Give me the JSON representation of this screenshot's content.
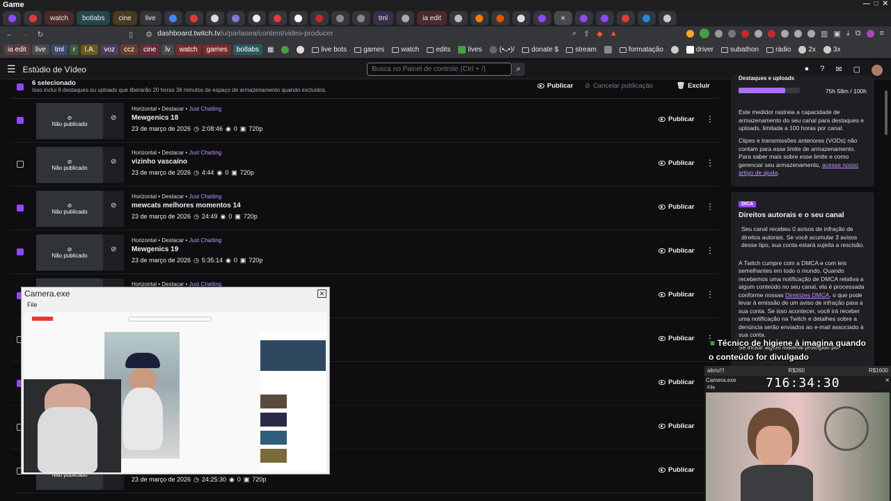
{
  "os_title": "Game",
  "tabs": [
    {
      "label": "",
      "kind": "icon"
    },
    {
      "label": "",
      "kind": "icon"
    },
    {
      "label": "watch",
      "kind": "group"
    },
    {
      "label": "botlabs",
      "kind": "group"
    },
    {
      "label": "cine",
      "kind": "group"
    },
    {
      "label": "live",
      "kind": "group"
    },
    {
      "label": "tml",
      "kind": "group"
    },
    {
      "label": "ia edit",
      "kind": "group"
    }
  ],
  "url": {
    "host": "dashboard.twitch.tv",
    "path": "/u/parlasea/content/video-producer"
  },
  "bookmarks": {
    "chips": [
      {
        "label": "ia edit",
        "color": "#5a3d3d"
      },
      {
        "label": "live",
        "color": "#4a4a4a"
      },
      {
        "label": "tml",
        "color": "#3c4a6e"
      },
      {
        "label": "r",
        "color": "#3c5a3c"
      },
      {
        "label": "I.A.",
        "color": "#6a5a1f"
      },
      {
        "label": "voz",
        "color": "#4a3d5e"
      },
      {
        "label": "ccz",
        "color": "#6a3d2a"
      },
      {
        "label": "cine",
        "color": "#6a2a3a"
      },
      {
        "label": "lv",
        "color": "#4a4a4a"
      },
      {
        "label": "watch",
        "color": "#7a2a2a"
      },
      {
        "label": "games",
        "color": "#7a2a2a"
      },
      {
        "label": "botlabs",
        "color": "#2a5a5e"
      }
    ],
    "items": [
      "live bots",
      "games",
      "watch",
      "edits",
      "lives",
      "(•ᴗ•)/",
      "donate $",
      "stream",
      "",
      "formatação",
      "",
      "driver",
      "subathon",
      "rádio",
      "2x",
      "3x"
    ]
  },
  "header": {
    "studio_title": "Estúdio de Vídeo",
    "search_placeholder": "Busca no Painel de controle (Ctrl + /)"
  },
  "selection": {
    "count": "6 selecionado",
    "info": "Isso inclui 6 destaques ou uploads que liberarão 20 horas 36 minutos de espaço de armazenamento quando excluídos.",
    "publish": "Publicar",
    "cancel_publish": "Cancelar publicação",
    "delete": "Excluir"
  },
  "videos": [
    {
      "checked": true,
      "meta_prefix": "Horizontal • Destacar • ",
      "category": "Just Chatting",
      "title": "Mewgenics 18",
      "date": "23 de março de 2026",
      "duration": "2:08:46",
      "views": "0",
      "quality": "720p",
      "status": "Não publicado",
      "action": "Publicar"
    },
    {
      "checked": false,
      "meta_prefix": "Horizontal • Destacar • ",
      "category": "Just Chatting",
      "title": "vizinho vascaíno",
      "date": "23 de março de 2026",
      "duration": "4:44",
      "views": "0",
      "quality": "720p",
      "status": "Não publicado",
      "action": "Publicar"
    },
    {
      "checked": true,
      "meta_prefix": "Horizontal • Destacar • ",
      "category": "Just Chatting",
      "title": "mewcats melhores momentos 14",
      "date": "23 de março de 2026",
      "duration": "24:49",
      "views": "0",
      "quality": "720p",
      "status": "Não publicado",
      "action": "Publicar"
    },
    {
      "checked": true,
      "meta_prefix": "Horizontal • Destacar • ",
      "category": "Just Chatting",
      "title": "Mewgenics 19",
      "date": "23 de março de 2026",
      "duration": "5:35:14",
      "views": "0",
      "quality": "720p",
      "status": "Não publicado",
      "action": "Publicar"
    },
    {
      "checked": true,
      "meta_prefix": "Horizontal • Destacar • ",
      "category": "Just Chatting",
      "title": "",
      "date": "",
      "duration": "",
      "views": "",
      "quality": "",
      "status": "",
      "action": "Publicar"
    },
    {
      "checked": false,
      "meta_prefix": "",
      "category": "",
      "title": "",
      "date": "",
      "duration": "",
      "views": "",
      "quality": "",
      "status": "",
      "action": "Publicar"
    },
    {
      "checked": true,
      "meta_prefix": "",
      "category": "",
      "title": "",
      "date": "",
      "duration": "",
      "views": "",
      "quality": "",
      "status": "",
      "action": "Publicar"
    },
    {
      "checked": false,
      "meta_prefix": "",
      "category": "",
      "title": "",
      "date": "",
      "duration": "",
      "views": "",
      "quality": "",
      "status": "",
      "action": "Publicar"
    },
    {
      "checked": false,
      "meta_prefix": "",
      "category": "",
      "title": "",
      "date": "23 de março de 2026",
      "duration": "24:25:30",
      "views": "0",
      "quality": "720p",
      "status": "Não publicado",
      "action": "Publicar"
    }
  ],
  "storage": {
    "title": "Destaques e uploads",
    "usage": "75h 58m / 100h",
    "progress_fraction": 0.76,
    "desc": "Este medidor rastreia a capacidade de armazenamento do seu canal para destaques e uploads, limitada a 100 horas por canal.",
    "desc2": "Clipes e transmissões anteriores (VODs) não contam para esse limite de armazenamento. Para saber mais sobre esse limite e como gerenciar seu armazenamento,",
    "link": "acesse nosso artigo de ajuda"
  },
  "copyright": {
    "tag": "DICA",
    "title": "Direitos autorais e o seu canal",
    "p1": "Seu canal recebeu 0 avisos de infração de direitos autorais. Se você acumular 3 avisos desse tipo, sua conta estará sujeita a rescisão.",
    "p2a": "A Twitch cumpre com a DMCA e com leis semelhantes em todo o mundo. Quando recebemos uma notificação de DMCA relativa a algum conteúdo no seu canal, ela é processada conforme nossas",
    "p2link": "Diretrizes DMCA",
    "p2b": ", o que pode levar à emissão de um aviso de infração para a sua conta. Se isso acontecer, você irá receber uma notificação na Twitch e detalhes sobre a denúncia serão enviados ao e-mail associado à sua conta.",
    "p3": "Se incluir algum material protegido por"
  },
  "camera_left": {
    "title": "Camera.exe",
    "menu": "File"
  },
  "overlay": {
    "line1": "Técnico de higiene à imagina quando",
    "line2": "o conteúdo for divulgado"
  },
  "camera_right": {
    "status_left": "abriu!!!",
    "status_mid": "R$360",
    "status_right": "R$1600",
    "title": "Camera.exe",
    "menu": "File",
    "timer": "716:34:30"
  },
  "colors": {
    "accent": "#9147ff",
    "link": "#bf94ff",
    "bg": "#0e0e10"
  }
}
